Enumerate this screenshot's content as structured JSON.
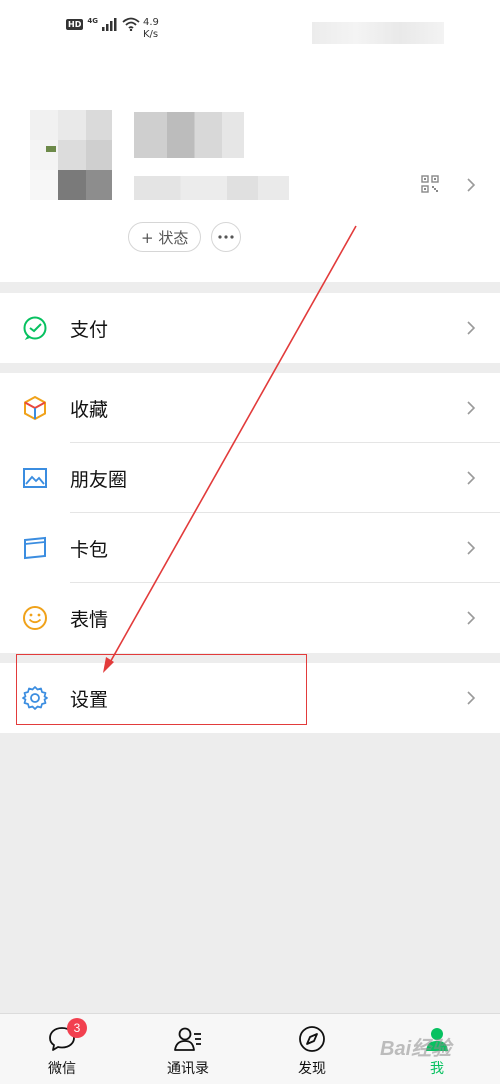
{
  "status_bar": {
    "hd": "HD",
    "network": "4G",
    "speed_value": "4.9",
    "speed_unit": "K/s"
  },
  "profile": {
    "status_button_label": "+ 状态"
  },
  "groups": [
    {
      "items": [
        {
          "label": "支付",
          "icon": "pay-icon"
        }
      ]
    },
    {
      "items": [
        {
          "label": "收藏",
          "icon": "favorites-icon"
        },
        {
          "label": "朋友圈",
          "icon": "moments-icon"
        },
        {
          "label": "卡包",
          "icon": "card-wallet-icon"
        },
        {
          "label": "表情",
          "icon": "emoji-icon"
        }
      ]
    },
    {
      "items": [
        {
          "label": "设置",
          "icon": "settings-icon"
        }
      ]
    }
  ],
  "tabbar": {
    "tabs": [
      {
        "label": "微信",
        "icon": "chat-icon",
        "badge": "3"
      },
      {
        "label": "通讯录",
        "icon": "contacts-icon"
      },
      {
        "label": "发现",
        "icon": "discover-compass-icon"
      },
      {
        "label": "我",
        "icon": "me-icon",
        "active": true
      }
    ]
  },
  "watermark": "Bai经验",
  "colors": {
    "accent_green": "#07c160",
    "annotation_red": "#e23b3b",
    "badge_red": "#f2404f"
  }
}
